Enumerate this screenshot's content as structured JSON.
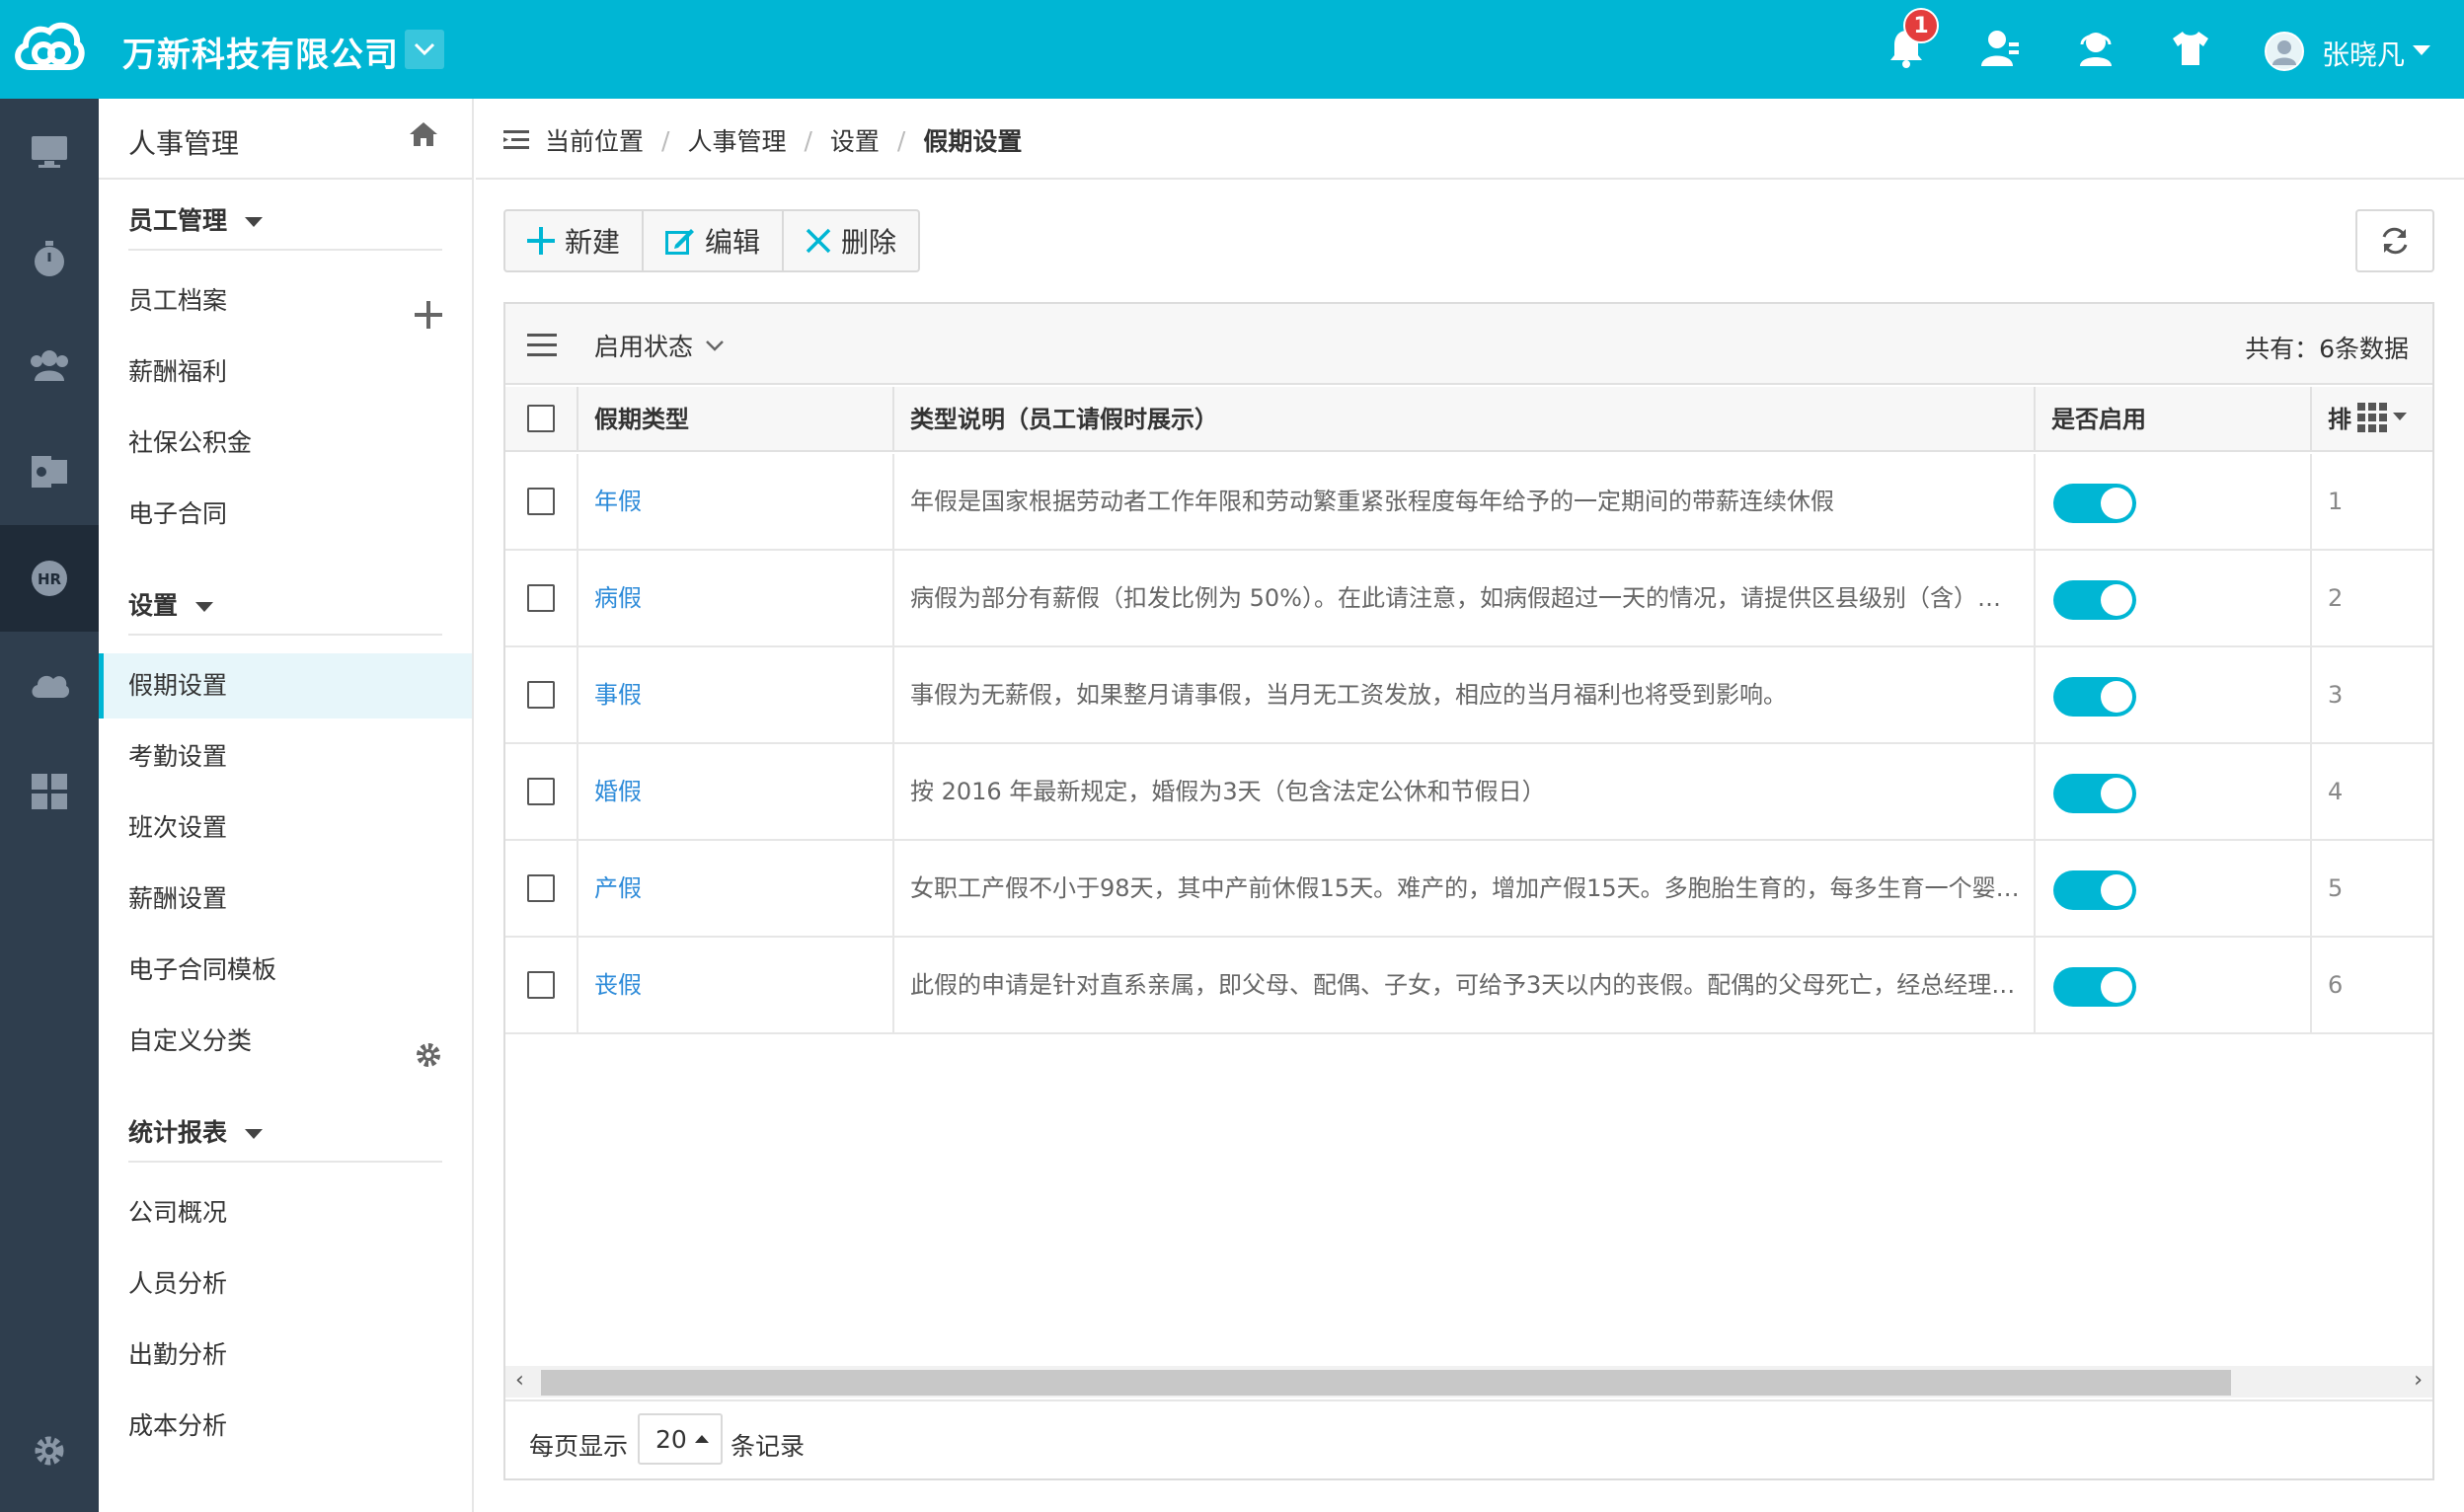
{
  "header": {
    "company": "万新科技有限公司",
    "notification_count": "1",
    "username": "张晓凡",
    "brand_color": "#00b6d4"
  },
  "sidebar": {
    "title": "人事管理",
    "groups": [
      {
        "label": "员工管理",
        "items": [
          "员工档案",
          "薪酬福利",
          "社保公积金",
          "电子合同"
        ]
      },
      {
        "label": "设置",
        "items": [
          "假期设置",
          "考勤设置",
          "班次设置",
          "薪酬设置",
          "电子合同模板",
          "自定义分类"
        ]
      },
      {
        "label": "统计报表",
        "items": [
          "公司概况",
          "人员分析",
          "出勤分析",
          "成本分析"
        ]
      }
    ],
    "active_item": "假期设置"
  },
  "breadcrumb": [
    "当前位置",
    "人事管理",
    "设置",
    "假期设置"
  ],
  "toolbar": {
    "new_label": "新建",
    "edit_label": "编辑",
    "delete_label": "删除"
  },
  "table": {
    "filter_label": "启用状态",
    "total_text": "共有：6条数据",
    "columns": [
      "假期类型",
      "类型说明（员工请假时展示）",
      "是否启用",
      "排"
    ],
    "rows": [
      {
        "type": "年假",
        "desc": "年假是国家根据劳动者工作年限和劳动繁重紧张程度每年给予的一定期间的带薪连续休假",
        "enabled": true,
        "order": "1"
      },
      {
        "type": "病假",
        "desc": "病假为部分有薪假（扣发比例为 50%）。在此请注意，如病假超过一天的情况，请提供区县级别（含）…",
        "enabled": true,
        "order": "2"
      },
      {
        "type": "事假",
        "desc": "事假为无薪假，如果整月请事假，当月无工资发放，相应的当月福利也将受到影响。",
        "enabled": true,
        "order": "3"
      },
      {
        "type": "婚假",
        "desc": "按 2016 年最新规定，婚假为3天（包含法定公休和节假日）",
        "enabled": true,
        "order": "4"
      },
      {
        "type": "产假",
        "desc": "女职工产假不小于98天，其中产前休假15天。难产的，增加产假15天。多胞胎生育的，每多生育一个婴儿…",
        "enabled": true,
        "order": "5"
      },
      {
        "type": "丧假",
        "desc": "此假的申请是针对直系亲属，即父母、配偶、子女，可给予3天以内的丧假。配偶的父母死亡，经总经理…",
        "enabled": true,
        "order": "6"
      }
    ]
  },
  "pager": {
    "label_before": "每页显示",
    "page_size": "20",
    "label_after": "条记录"
  }
}
